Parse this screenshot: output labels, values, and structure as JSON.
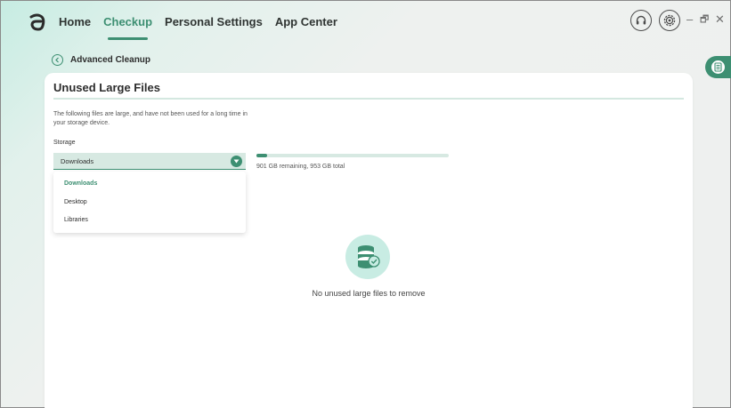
{
  "colors": {
    "accent": "#3d8f72",
    "accent_light": "#d7e9e2",
    "icon_bg": "#c8ece3"
  },
  "nav": {
    "items": [
      {
        "label": "Home",
        "active": false
      },
      {
        "label": "Checkup",
        "active": true
      },
      {
        "label": "Personal Settings",
        "active": false
      },
      {
        "label": "App Center",
        "active": false
      }
    ]
  },
  "header_icons": [
    "headset-icon",
    "settings-icon"
  ],
  "window_controls": {
    "minimize": "–",
    "restore": "🗗",
    "close": "✕"
  },
  "back": {
    "label": "Advanced Cleanup"
  },
  "card": {
    "title": "Unused Large Files",
    "description": "The following files are large, and have not been used for a long time in your storage device.",
    "storage_label": "Storage",
    "select": {
      "value": "Downloads",
      "options": [
        "Downloads",
        "Desktop",
        "Libraries"
      ]
    },
    "storage_usage": {
      "fraction_used": 0.055,
      "text": "901 GB remaining, 953 GB total"
    },
    "empty_message": "No unused large files to remove"
  }
}
